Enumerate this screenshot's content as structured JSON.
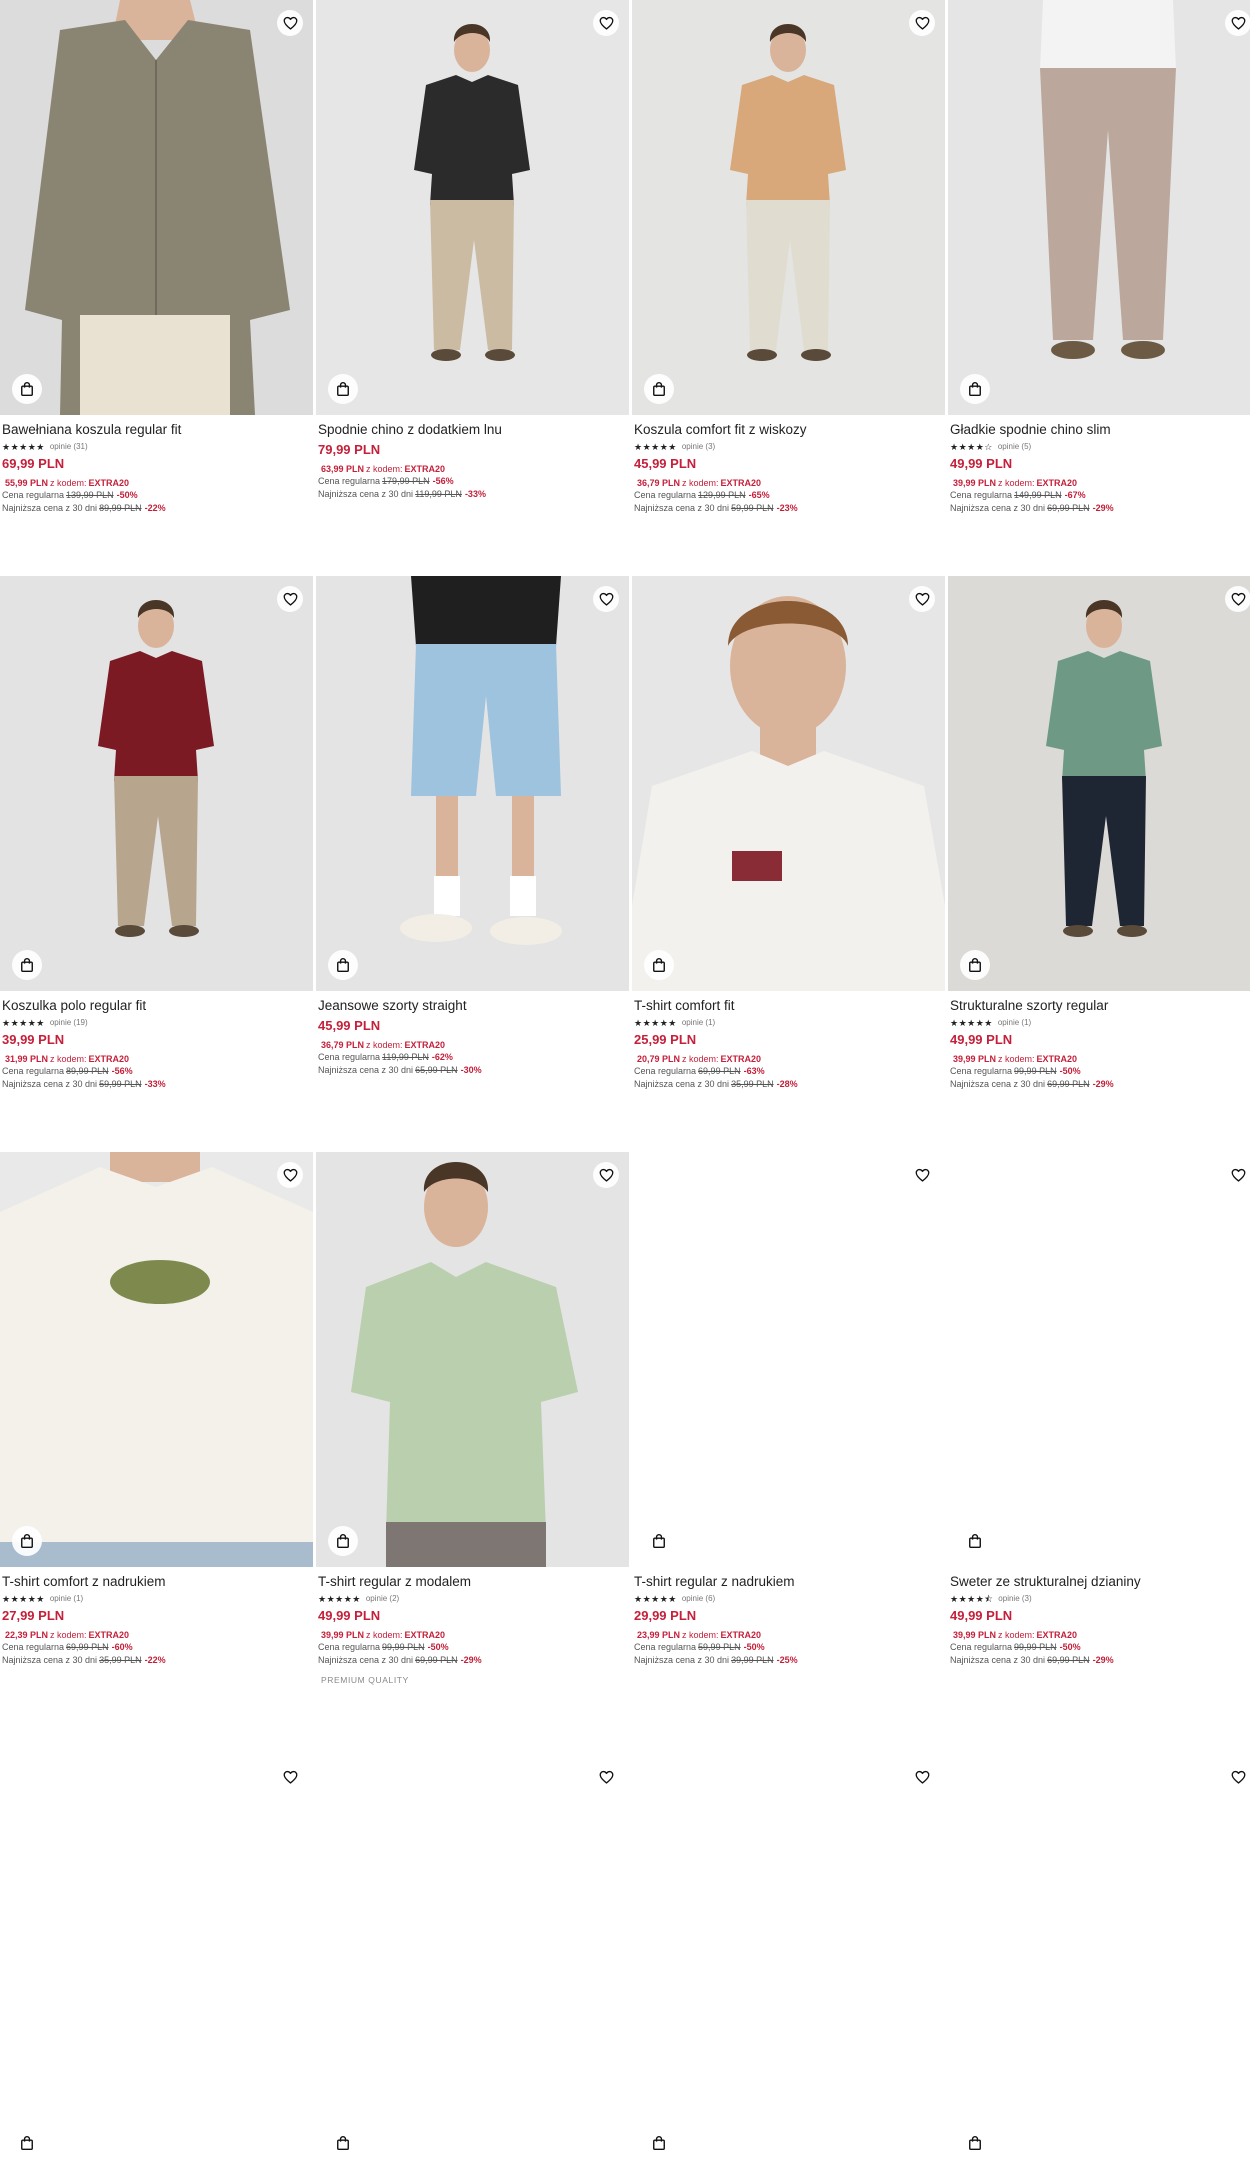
{
  "labels": {
    "regular": "Cena regularna",
    "lowest": "Najniższa cena z 30 dni",
    "with_code": "z kodem:"
  },
  "colors": {
    "price_red": "#c4203a",
    "text": "#222222"
  },
  "icons": {
    "favorite": "heart-icon",
    "bag": "shopping-bag-icon"
  },
  "products": [
    {
      "name": "Bawełniana koszula regular fit",
      "stars": "★★★★★",
      "reviews": "opinie (31)",
      "price": "69,99 PLN",
      "code_price": "55,99 PLN",
      "code": "EXTRA20",
      "regular_old": "139,99 PLN",
      "regular_disc": "-50%",
      "lowest_old": "89,99 PLN",
      "lowest_disc": "-22%",
      "image": {
        "bg": "#dcdcdc",
        "garment": "#8a8473",
        "legs": "#e9e2d2",
        "kind": "shirt-closeup"
      }
    },
    {
      "name": "Spodnie chino z dodatkiem lnu",
      "stars": "",
      "reviews": "",
      "price": "79,99 PLN",
      "code_price": "63,99 PLN",
      "code": "EXTRA20",
      "regular_old": "179,99 PLN",
      "regular_disc": "-56%",
      "lowest_old": "119,99 PLN",
      "lowest_disc": "-33%",
      "image": {
        "bg": "#e6e6e6",
        "garment": "#2b2b2b",
        "legs": "#cbbba2",
        "kind": "full"
      }
    },
    {
      "name": "Koszula comfort fit z wiskozy",
      "stars": "★★★★★",
      "reviews": "opinie (3)",
      "price": "45,99 PLN",
      "code_price": "36,79 PLN",
      "code": "EXTRA20",
      "regular_old": "129,99 PLN",
      "regular_disc": "-65%",
      "lowest_old": "59,99 PLN",
      "lowest_disc": "-23%",
      "image": {
        "bg": "#e4e4e2",
        "garment": "#d8a77a",
        "legs": "#e0dccf",
        "kind": "full"
      }
    },
    {
      "name": "Gładkie spodnie chino slim",
      "stars": "★★★★☆",
      "reviews": "opinie (5)",
      "price": "49,99 PLN",
      "code_price": "39,99 PLN",
      "code": "EXTRA20",
      "regular_old": "149,99 PLN",
      "regular_disc": "-67%",
      "lowest_old": "69,99 PLN",
      "lowest_disc": "-29%",
      "image": {
        "bg": "#e5e5e5",
        "garment": "#f3f3f3",
        "legs": "#bba79c",
        "kind": "pants"
      }
    },
    {
      "name": "Koszulka polo regular fit",
      "stars": "★★★★★",
      "reviews": "opinie (19)",
      "price": "39,99 PLN",
      "code_price": "31,99 PLN",
      "code": "EXTRA20",
      "regular_old": "89,99 PLN",
      "regular_disc": "-56%",
      "lowest_old": "59,99 PLN",
      "lowest_disc": "-33%",
      "image": {
        "bg": "#e3e3e3",
        "garment": "#7b1a22",
        "legs": "#b7a58d",
        "kind": "full"
      }
    },
    {
      "name": "Jeansowe szorty straight",
      "stars": "",
      "reviews": "",
      "price": "45,99 PLN",
      "code_price": "36,79 PLN",
      "code": "EXTRA20",
      "regular_old": "119,99 PLN",
      "regular_disc": "-62%",
      "lowest_old": "65,99 PLN",
      "lowest_disc": "-30%",
      "image": {
        "bg": "#e4e4e4",
        "garment": "#1f1f1f",
        "legs": "#9ec3de",
        "kind": "shorts"
      }
    },
    {
      "name": "T-shirt comfort fit",
      "stars": "★★★★★",
      "reviews": "opinie (1)",
      "price": "25,99 PLN",
      "code_price": "20,79 PLN",
      "code": "EXTRA20",
      "regular_old": "69,99 PLN",
      "regular_disc": "-63%",
      "lowest_old": "35,99 PLN",
      "lowest_disc": "-28%",
      "image": {
        "bg": "#e6e6e6",
        "garment": "#f3f1ee",
        "legs": "#f3f1ee",
        "kind": "portrait"
      }
    },
    {
      "name": "Strukturalne szorty regular",
      "stars": "★★★★★",
      "reviews": "opinie (1)",
      "price": "49,99 PLN",
      "code_price": "39,99 PLN",
      "code": "EXTRA20",
      "regular_old": "99,99 PLN",
      "regular_disc": "-50%",
      "lowest_old": "69,99 PLN",
      "lowest_disc": "-29%",
      "image": {
        "bg": "#dcdad6",
        "garment": "#6e9a85",
        "legs": "#1e2533",
        "kind": "full"
      }
    },
    {
      "name": "T-shirt comfort z nadrukiem",
      "stars": "★★★★★",
      "reviews": "opinie (1)",
      "price": "27,99 PLN",
      "code_price": "22,39 PLN",
      "code": "EXTRA20",
      "regular_old": "69,99 PLN",
      "regular_disc": "-60%",
      "lowest_old": "35,99 PLN",
      "lowest_disc": "-22%",
      "image": {
        "bg": "#e9e9e9",
        "garment": "#f4f1ea",
        "legs": "#a9bccd",
        "kind": "tee-closeup"
      }
    },
    {
      "name": "T-shirt regular z modalem",
      "stars": "★★★★★",
      "reviews": "opinie (2)",
      "price": "49,99 PLN",
      "code_price": "39,99 PLN",
      "code": "EXTRA20",
      "regular_old": "99,99 PLN",
      "regular_disc": "-50%",
      "lowest_old": "69,99 PLN",
      "lowest_disc": "-29%",
      "badge": "PREMIUM QUALITY",
      "image": {
        "bg": "#e4e4e4",
        "garment": "#b9cfae",
        "legs": "#7d7672",
        "kind": "tee-mid"
      }
    },
    {
      "name": "T-shirt regular z nadrukiem",
      "stars": "★★★★★",
      "reviews": "opinie (6)",
      "price": "29,99 PLN",
      "code_price": "23,99 PLN",
      "code": "EXTRA20",
      "regular_old": "59,99 PLN",
      "regular_disc": "-50%",
      "lowest_old": "39,99 PLN",
      "lowest_disc": "-25%",
      "image": {
        "kind": "empty"
      }
    },
    {
      "name": "Sweter ze strukturalnej dzianiny",
      "stars": "★★★★⯪",
      "reviews": "opinie (3)",
      "price": "49,99 PLN",
      "code_price": "39,99 PLN",
      "code": "EXTRA20",
      "regular_old": "99,99 PLN",
      "regular_disc": "-50%",
      "lowest_old": "69,99 PLN",
      "lowest_disc": "-29%",
      "image": {
        "kind": "empty"
      }
    },
    {
      "image": {
        "kind": "empty"
      }
    },
    {
      "image": {
        "kind": "empty"
      }
    },
    {
      "image": {
        "kind": "empty"
      }
    },
    {
      "image": {
        "kind": "empty"
      }
    }
  ]
}
